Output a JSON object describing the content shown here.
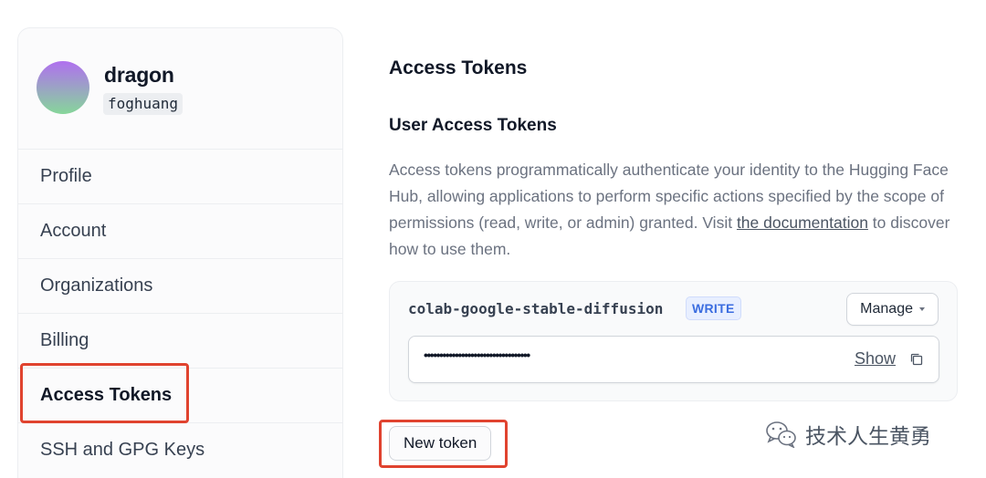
{
  "profile": {
    "display_name": "dragon",
    "username": "foghuang"
  },
  "sidebar": {
    "items": [
      {
        "label": "Profile",
        "active": false
      },
      {
        "label": "Account",
        "active": false
      },
      {
        "label": "Organizations",
        "active": false
      },
      {
        "label": "Billing",
        "active": false
      },
      {
        "label": "Access Tokens",
        "active": true
      },
      {
        "label": "SSH and GPG Keys",
        "active": false
      }
    ]
  },
  "main": {
    "title": "Access Tokens",
    "section_title": "User Access Tokens",
    "description": {
      "text_before": "Access tokens programmatically authenticate your identity to the Hugging Face Hub, allowing applications to perform specific actions specified by the scope of permissions (read, write, or admin) granted. Visit ",
      "link_text": "the documentation",
      "text_after": " to discover how to use them."
    },
    "token": {
      "name": "colab-google-stable-diffusion",
      "role_badge": "WRITE",
      "manage_label": "Manage",
      "masked_value": "••••••••••••••••••••••••••••••••••",
      "show_label": "Show"
    },
    "new_token_label": "New token"
  },
  "watermark": {
    "text": "技术人生黄勇"
  },
  "colors": {
    "highlight": "#e0432f",
    "badge_text": "#3b6de0",
    "badge_bg": "#e8efff"
  },
  "icons": {
    "copy": "copy-icon",
    "manage_caret": "chevron-down-icon",
    "watermark": "wechat-icon"
  }
}
